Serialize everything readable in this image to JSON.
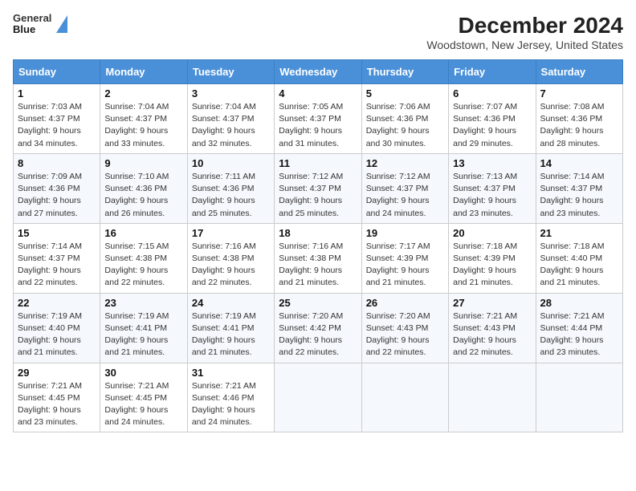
{
  "header": {
    "logo_line1": "General",
    "logo_line2": "Blue",
    "title": "December 2024",
    "subtitle": "Woodstown, New Jersey, United States"
  },
  "columns": [
    "Sunday",
    "Monday",
    "Tuesday",
    "Wednesday",
    "Thursday",
    "Friday",
    "Saturday"
  ],
  "weeks": [
    [
      {
        "day": "1",
        "info": "Sunrise: 7:03 AM\nSunset: 4:37 PM\nDaylight: 9 hours and 34 minutes."
      },
      {
        "day": "2",
        "info": "Sunrise: 7:04 AM\nSunset: 4:37 PM\nDaylight: 9 hours and 33 minutes."
      },
      {
        "day": "3",
        "info": "Sunrise: 7:04 AM\nSunset: 4:37 PM\nDaylight: 9 hours and 32 minutes."
      },
      {
        "day": "4",
        "info": "Sunrise: 7:05 AM\nSunset: 4:37 PM\nDaylight: 9 hours and 31 minutes."
      },
      {
        "day": "5",
        "info": "Sunrise: 7:06 AM\nSunset: 4:36 PM\nDaylight: 9 hours and 30 minutes."
      },
      {
        "day": "6",
        "info": "Sunrise: 7:07 AM\nSunset: 4:36 PM\nDaylight: 9 hours and 29 minutes."
      },
      {
        "day": "7",
        "info": "Sunrise: 7:08 AM\nSunset: 4:36 PM\nDaylight: 9 hours and 28 minutes."
      }
    ],
    [
      {
        "day": "8",
        "info": "Sunrise: 7:09 AM\nSunset: 4:36 PM\nDaylight: 9 hours and 27 minutes."
      },
      {
        "day": "9",
        "info": "Sunrise: 7:10 AM\nSunset: 4:36 PM\nDaylight: 9 hours and 26 minutes."
      },
      {
        "day": "10",
        "info": "Sunrise: 7:11 AM\nSunset: 4:36 PM\nDaylight: 9 hours and 25 minutes."
      },
      {
        "day": "11",
        "info": "Sunrise: 7:12 AM\nSunset: 4:37 PM\nDaylight: 9 hours and 25 minutes."
      },
      {
        "day": "12",
        "info": "Sunrise: 7:12 AM\nSunset: 4:37 PM\nDaylight: 9 hours and 24 minutes."
      },
      {
        "day": "13",
        "info": "Sunrise: 7:13 AM\nSunset: 4:37 PM\nDaylight: 9 hours and 23 minutes."
      },
      {
        "day": "14",
        "info": "Sunrise: 7:14 AM\nSunset: 4:37 PM\nDaylight: 9 hours and 23 minutes."
      }
    ],
    [
      {
        "day": "15",
        "info": "Sunrise: 7:14 AM\nSunset: 4:37 PM\nDaylight: 9 hours and 22 minutes."
      },
      {
        "day": "16",
        "info": "Sunrise: 7:15 AM\nSunset: 4:38 PM\nDaylight: 9 hours and 22 minutes."
      },
      {
        "day": "17",
        "info": "Sunrise: 7:16 AM\nSunset: 4:38 PM\nDaylight: 9 hours and 22 minutes."
      },
      {
        "day": "18",
        "info": "Sunrise: 7:16 AM\nSunset: 4:38 PM\nDaylight: 9 hours and 21 minutes."
      },
      {
        "day": "19",
        "info": "Sunrise: 7:17 AM\nSunset: 4:39 PM\nDaylight: 9 hours and 21 minutes."
      },
      {
        "day": "20",
        "info": "Sunrise: 7:18 AM\nSunset: 4:39 PM\nDaylight: 9 hours and 21 minutes."
      },
      {
        "day": "21",
        "info": "Sunrise: 7:18 AM\nSunset: 4:40 PM\nDaylight: 9 hours and 21 minutes."
      }
    ],
    [
      {
        "day": "22",
        "info": "Sunrise: 7:19 AM\nSunset: 4:40 PM\nDaylight: 9 hours and 21 minutes."
      },
      {
        "day": "23",
        "info": "Sunrise: 7:19 AM\nSunset: 4:41 PM\nDaylight: 9 hours and 21 minutes."
      },
      {
        "day": "24",
        "info": "Sunrise: 7:19 AM\nSunset: 4:41 PM\nDaylight: 9 hours and 21 minutes."
      },
      {
        "day": "25",
        "info": "Sunrise: 7:20 AM\nSunset: 4:42 PM\nDaylight: 9 hours and 22 minutes."
      },
      {
        "day": "26",
        "info": "Sunrise: 7:20 AM\nSunset: 4:43 PM\nDaylight: 9 hours and 22 minutes."
      },
      {
        "day": "27",
        "info": "Sunrise: 7:21 AM\nSunset: 4:43 PM\nDaylight: 9 hours and 22 minutes."
      },
      {
        "day": "28",
        "info": "Sunrise: 7:21 AM\nSunset: 4:44 PM\nDaylight: 9 hours and 23 minutes."
      }
    ],
    [
      {
        "day": "29",
        "info": "Sunrise: 7:21 AM\nSunset: 4:45 PM\nDaylight: 9 hours and 23 minutes."
      },
      {
        "day": "30",
        "info": "Sunrise: 7:21 AM\nSunset: 4:45 PM\nDaylight: 9 hours and 24 minutes."
      },
      {
        "day": "31",
        "info": "Sunrise: 7:21 AM\nSunset: 4:46 PM\nDaylight: 9 hours and 24 minutes."
      },
      null,
      null,
      null,
      null
    ]
  ]
}
